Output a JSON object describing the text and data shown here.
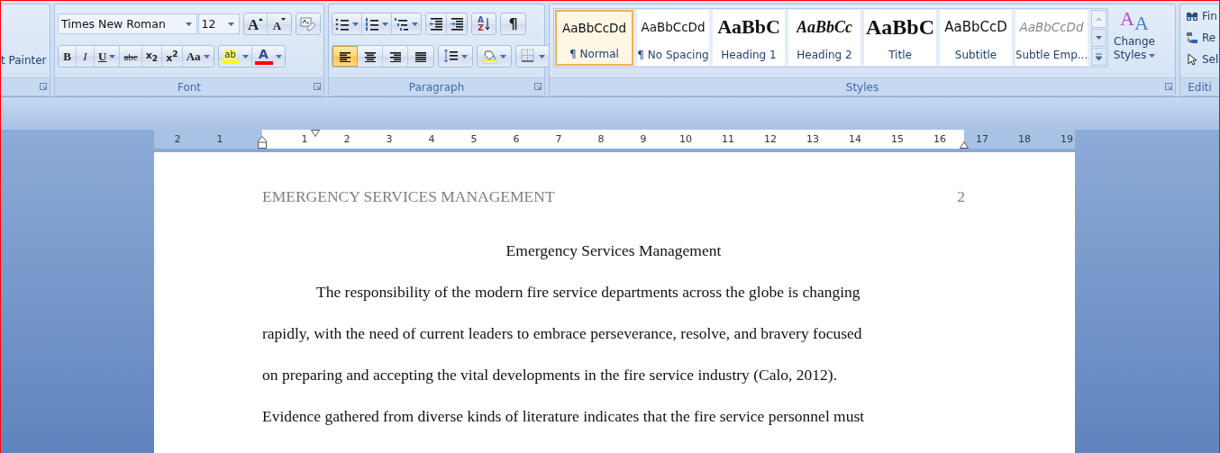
{
  "ribbon": {
    "clipboard": {
      "format_painter": "t Painter"
    },
    "font": {
      "label": "Font",
      "font_name": "Times New Roman",
      "font_size": "12",
      "grow": "A",
      "shrink": "A",
      "buttons": [
        {
          "label": "B",
          "kind": "bold",
          "dropdown": false
        },
        {
          "label": "I",
          "kind": "italic",
          "dropdown": false
        },
        {
          "label": "U",
          "kind": "underline",
          "dropdown": true
        },
        {
          "label": "abc",
          "kind": "strike",
          "dropdown": false
        },
        {
          "label": "x$_{2}$",
          "kind": "subscript",
          "dropdown": false
        },
        {
          "label": "x$^{2}$",
          "kind": "superscript",
          "dropdown": false
        },
        {
          "label": "Aa",
          "kind": "case",
          "dropdown": true
        }
      ],
      "colors": [
        {
          "label": "ab",
          "kind": "highlight",
          "color": "#ffff00"
        },
        {
          "label": "A",
          "kind": "fontcolor",
          "color": "#ff0000"
        }
      ]
    },
    "paragraph": {
      "label": "Paragraph",
      "row1": [
        {
          "kind": "bullets"
        },
        {
          "kind": "numbering"
        },
        {
          "kind": "multilevel"
        },
        {
          "kind": "outdent"
        },
        {
          "kind": "indent"
        },
        {
          "kind": "sort",
          "top": "A",
          "bottom": "Z"
        },
        {
          "kind": "pilcrow",
          "label": "¶"
        }
      ],
      "align": [
        {
          "kind": "left",
          "selected": true
        },
        {
          "kind": "center",
          "selected": false
        },
        {
          "kind": "right",
          "selected": false
        },
        {
          "kind": "justify",
          "selected": false
        }
      ],
      "row2": [
        {
          "kind": "spacing"
        },
        {
          "kind": "shading"
        },
        {
          "kind": "borders"
        }
      ]
    },
    "styles": {
      "label": "Styles",
      "gallery": [
        {
          "preview": "AaBbCcDd",
          "name": "¶ Normal",
          "kind": "normal",
          "selected": true
        },
        {
          "preview": "AaBbCcDd",
          "name": "¶ No Spacing",
          "kind": "normal",
          "selected": false
        },
        {
          "preview": "AaBbC",
          "name": "Heading 1",
          "kind": "heading",
          "selected": false
        },
        {
          "preview": "AaBbCc",
          "name": "Heading 2",
          "kind": "heading-italic",
          "selected": false
        },
        {
          "preview": "AaBbC",
          "name": "Title",
          "kind": "title",
          "selected": false
        },
        {
          "preview": "AaBbCcD",
          "name": "Subtitle",
          "kind": "subtitle",
          "selected": false
        },
        {
          "preview": "AaBbCcDd",
          "name": "Subtle Emp...",
          "kind": "subtle",
          "selected": false
        }
      ],
      "change": {
        "glyphs": [
          "A",
          "A"
        ],
        "label": "Change",
        "label2": "Styles"
      }
    },
    "editing": {
      "label": "Editi",
      "items": [
        {
          "label": "Fin",
          "kind": "find"
        },
        {
          "label": "Re",
          "kind": "replace"
        },
        {
          "label": "Sel",
          "kind": "select"
        }
      ]
    }
  },
  "ruler": {
    "marks": [
      {
        "label": "2",
        "in_margin": true
      },
      {
        "label": "1",
        "in_margin": true
      },
      {
        "label": "1",
        "in_margin": false
      },
      {
        "label": "2",
        "in_margin": false
      },
      {
        "label": "3",
        "in_margin": false
      },
      {
        "label": "4",
        "in_margin": false
      },
      {
        "label": "5",
        "in_margin": false
      },
      {
        "label": "6",
        "in_margin": false
      },
      {
        "label": "7",
        "in_margin": false
      },
      {
        "label": "8",
        "in_margin": false
      },
      {
        "label": "9",
        "in_margin": false
      },
      {
        "label": "10",
        "in_margin": false
      },
      {
        "label": "11",
        "in_margin": false
      },
      {
        "label": "12",
        "in_margin": false
      },
      {
        "label": "13",
        "in_margin": false
      },
      {
        "label": "14",
        "in_margin": false
      },
      {
        "label": "15",
        "in_margin": false
      },
      {
        "label": "16",
        "in_margin": false
      },
      {
        "label": "17",
        "in_margin": true
      },
      {
        "label": "18",
        "in_margin": true
      },
      {
        "label": "19",
        "in_margin": true
      }
    ]
  },
  "document": {
    "header": "EMERGENCY SERVICES MANAGEMENT",
    "page_number": "2",
    "title": "Emergency Services Management",
    "lines": [
      {
        "text": "The responsibility of the modern fire service departments across the globe is changing",
        "indent": true
      },
      {
        "text": "rapidly, with the need of current leaders to embrace perseverance, resolve, and bravery focused",
        "indent": false
      },
      {
        "text": "on preparing and accepting the vital developments in the fire service industry (Calo, 2012).",
        "indent": false
      },
      {
        "text": "Evidence gathered from diverse kinds of literature indicates that the fire service personnel must",
        "indent": false
      }
    ]
  }
}
